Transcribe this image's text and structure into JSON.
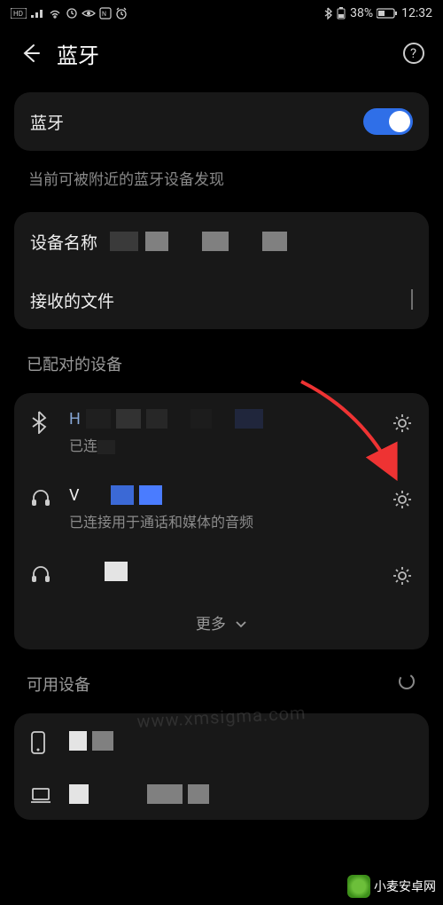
{
  "statusbar": {
    "battery_pct": "38%",
    "time": "12:32"
  },
  "header": {
    "title": "蓝牙"
  },
  "bt": {
    "label": "蓝牙",
    "discoverable_text": "当前可被附近的蓝牙设备发现"
  },
  "device_name": {
    "label": "设备名称"
  },
  "received_files": {
    "label": "接收的文件"
  },
  "paired_section": {
    "title": "已配对的设备",
    "more_label": "更多"
  },
  "devices": [
    {
      "name_prefix": "H",
      "status_prefix": "已连"
    },
    {
      "name_prefix": "V",
      "status": "已连接用于通话和媒体的音频"
    },
    {
      "name_prefix": "",
      "status": ""
    }
  ],
  "available_section": {
    "title": "可用设备"
  },
  "watermark": {
    "site": "小麦安卓网",
    "url": "www.xmsigma.com"
  }
}
